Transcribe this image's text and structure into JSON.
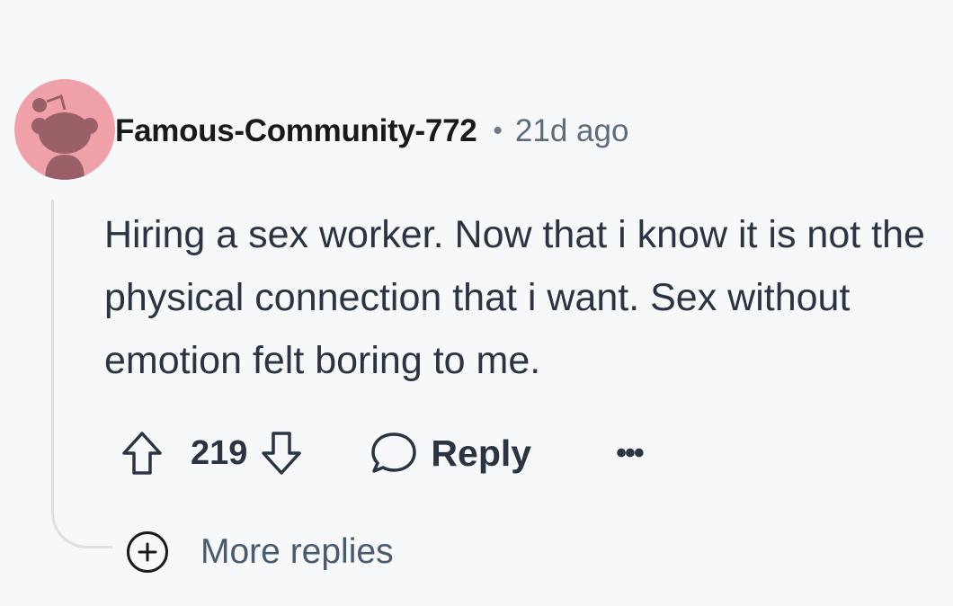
{
  "comment": {
    "author": "Famous-Community-772",
    "separator": "•",
    "timestamp": "21d ago",
    "body": "Hiring a sex worker. Now that i know it is not the physical connection that i want. Sex without emotion felt boring to me.",
    "score": "219",
    "reply_label": "Reply",
    "overflow_label": "•••",
    "more_replies_label": "More replies"
  },
  "colors": {
    "avatar_bg": "#f0a0a8",
    "avatar_figure": "#9a6068",
    "text_primary": "#1a1a1b",
    "text_body": "#2a3442",
    "text_meta": "#5c6c7d",
    "thread_line": "#dde1e6",
    "page_bg": "#f7f8fa"
  },
  "icons": {
    "avatar": "reddit-snoo-avatar",
    "upvote": "arrow-up-outline-icon",
    "downvote": "arrow-down-outline-icon",
    "reply": "speech-bubble-icon",
    "overflow": "ellipsis-icon",
    "more_replies": "plus-circle-icon"
  }
}
